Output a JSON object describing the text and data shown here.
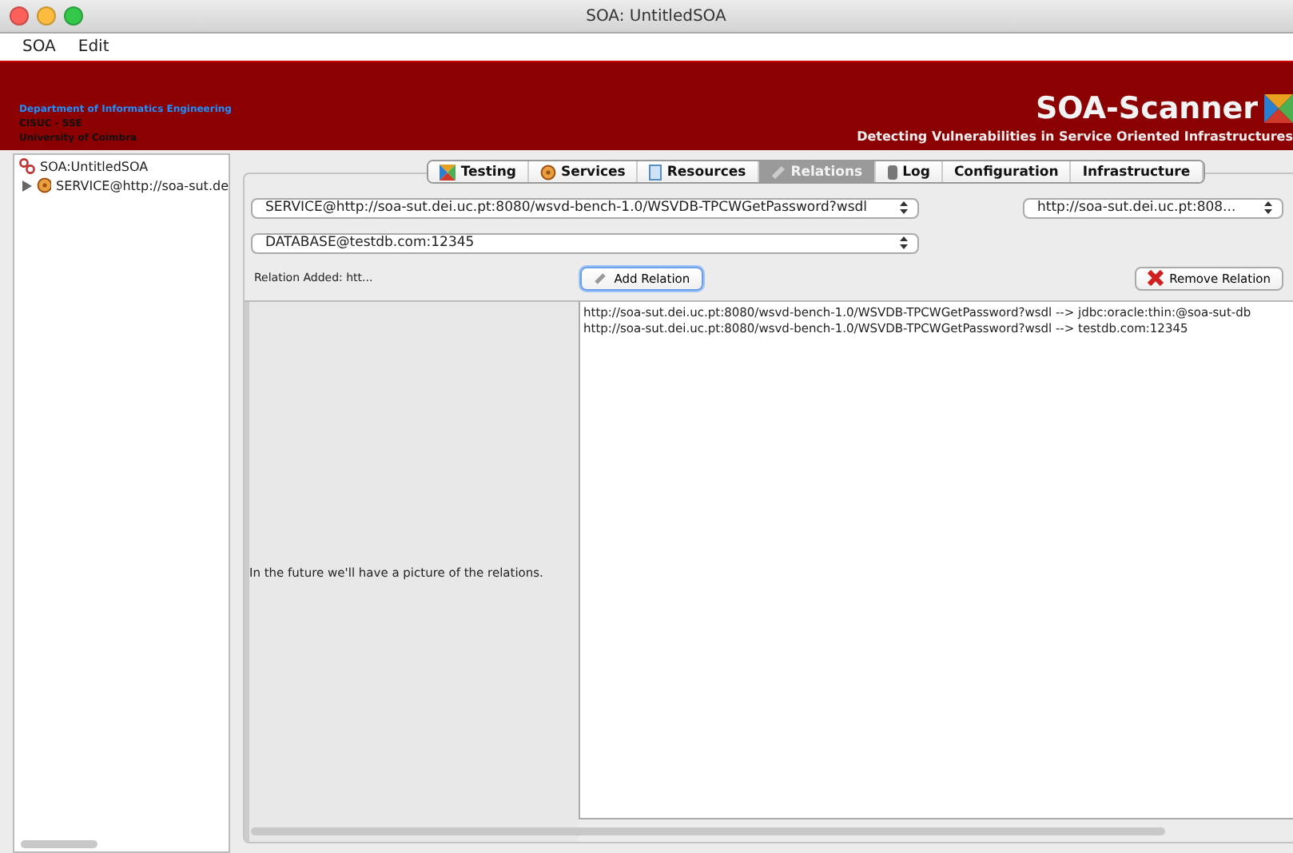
{
  "window": {
    "title": "SOA: UntitledSOA"
  },
  "menu": [
    "SOA",
    "Edit"
  ],
  "banner": {
    "lines": [
      "Department of Informatics Engineering",
      "CISUC - SSE",
      "University of Coimbra"
    ],
    "title": "SOA-Scanner",
    "subtitle": "Detecting Vulnerabilities in Service Oriented Infrastructures"
  },
  "tree": {
    "label": "SOA:UntitledSOA",
    "children": [
      {
        "label": "SERVICE@http://soa-sut.de",
        "expanded": false
      }
    ]
  },
  "tabs": [
    {
      "label": "Testing",
      "selected": false
    },
    {
      "label": "Services",
      "selected": false
    },
    {
      "label": "Resources",
      "selected": false
    },
    {
      "label": "Relations",
      "selected": true
    },
    {
      "label": "Log",
      "selected": false
    },
    {
      "label": "Configuration",
      "selected": false
    },
    {
      "label": "Infrastructure",
      "selected": false
    }
  ],
  "service_select": {
    "value": "SERVICE@http://soa-sut.dei.uc.pt:8080/wsvd-bench-1.0/WSVDB-TPCWGetPassword?wsdl"
  },
  "endpoint_select": {
    "value": "http://soa-sut.dei.uc.pt:808..."
  },
  "database_select": {
    "value": "DATABASE@testdb.com:12345"
  },
  "status": "Relation Added: htt...",
  "buttons": [
    {
      "label": "Add Relation",
      "kind": "add",
      "focused": true
    },
    {
      "label": "Remove Relation",
      "kind": "remove",
      "focused": false
    }
  ],
  "placeholder_text": "In the future we'll have a picture of the relations.",
  "relations": [
    "http://soa-sut.dei.uc.pt:8080/wsvd-bench-1.0/WSVDB-TPCWGetPassword?wsdl --> jdbc:oracle:thin:@soa-sut-db",
    "http://soa-sut.dei.uc.pt:8080/wsvd-bench-1.0/WSVDB-TPCWGetPassword?wsdl --> testdb.com:12345"
  ]
}
